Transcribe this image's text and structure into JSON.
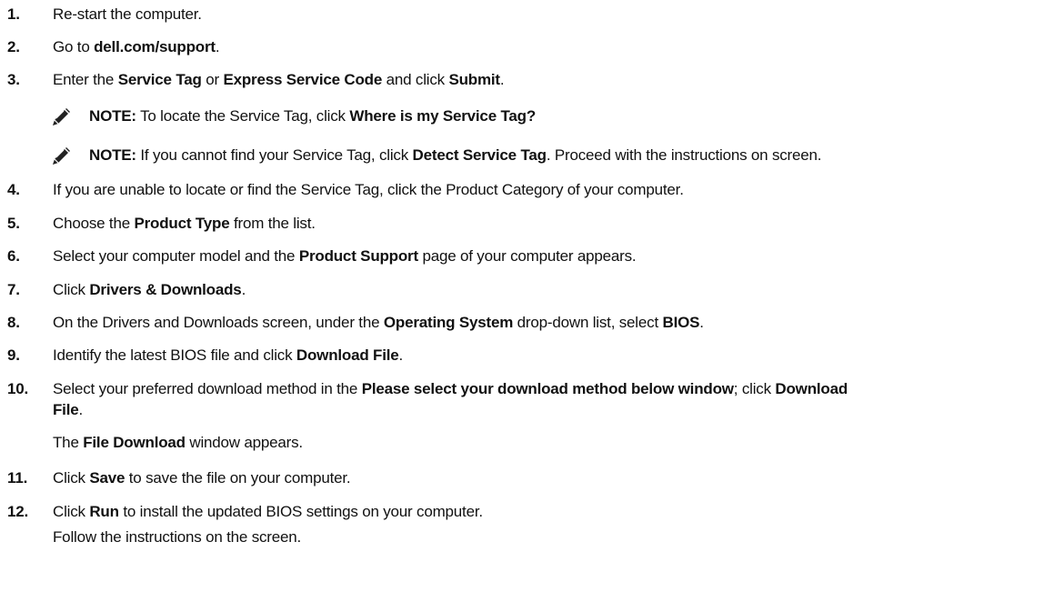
{
  "steps": [
    {
      "num": "1.",
      "parts": [
        {
          "t": "Re-start the computer.",
          "b": false
        }
      ]
    },
    {
      "num": "2.",
      "parts": [
        {
          "t": "Go to ",
          "b": false
        },
        {
          "t": "dell.com/support",
          "b": true
        },
        {
          "t": ".",
          "b": false
        }
      ]
    },
    {
      "num": "3.",
      "parts": [
        {
          "t": "Enter the ",
          "b": false
        },
        {
          "t": "Service Tag",
          "b": true
        },
        {
          "t": " or ",
          "b": false
        },
        {
          "t": "Express Service Code",
          "b": true
        },
        {
          "t": " and click ",
          "b": false
        },
        {
          "t": "Submit",
          "b": true
        },
        {
          "t": ".",
          "b": false
        }
      ]
    },
    {
      "num": "4.",
      "parts": [
        {
          "t": "If you are unable to locate or find the Service Tag, click the Product Category of your computer.",
          "b": false
        }
      ]
    },
    {
      "num": "5.",
      "parts": [
        {
          "t": "Choose the ",
          "b": false
        },
        {
          "t": "Product Type",
          "b": true
        },
        {
          "t": " from the list.",
          "b": false
        }
      ]
    },
    {
      "num": "6.",
      "parts": [
        {
          "t": "Select your computer model and the ",
          "b": false
        },
        {
          "t": "Product Support",
          "b": true
        },
        {
          "t": " page of your computer appears.",
          "b": false
        }
      ]
    },
    {
      "num": "7.",
      "parts": [
        {
          "t": "Click ",
          "b": false
        },
        {
          "t": "Drivers & Downloads",
          "b": true
        },
        {
          "t": ".",
          "b": false
        }
      ]
    },
    {
      "num": "8.",
      "parts": [
        {
          "t": "On the Drivers and Downloads screen, under the ",
          "b": false
        },
        {
          "t": "Operating System",
          "b": true
        },
        {
          "t": " drop-down list, select ",
          "b": false
        },
        {
          "t": "BIOS",
          "b": true
        },
        {
          "t": ".",
          "b": false
        }
      ]
    },
    {
      "num": "9.",
      "parts": [
        {
          "t": "Identify the latest BIOS file and click ",
          "b": false
        },
        {
          "t": "Download File",
          "b": true
        },
        {
          "t": ".",
          "b": false
        }
      ]
    },
    {
      "num": "10.",
      "parts": [
        {
          "t": "Select your preferred download method in the ",
          "b": false
        },
        {
          "t": "Please select your download method below window",
          "b": true
        },
        {
          "t": "; click ",
          "b": false
        },
        {
          "t": "Download",
          "b": true
        }
      ]
    },
    {
      "num": "11.",
      "parts": [
        {
          "t": "Click ",
          "b": false
        },
        {
          "t": "Save",
          "b": true
        },
        {
          "t": " to save the file on your computer.",
          "b": false
        }
      ]
    },
    {
      "num": "12.",
      "parts": [
        {
          "t": "Click ",
          "b": false
        },
        {
          "t": "Run",
          "b": true
        },
        {
          "t": " to install the updated BIOS settings on your computer.",
          "b": false
        }
      ]
    }
  ],
  "step10_cont": [
    {
      "t": "File",
      "b": true
    },
    {
      "t": ".",
      "b": false
    }
  ],
  "step10_sub": [
    {
      "t": "The ",
      "b": false
    },
    {
      "t": "File Download",
      "b": true
    },
    {
      "t": " window appears.",
      "b": false
    }
  ],
  "step12_sub": [
    {
      "t": "Follow the instructions on the screen.",
      "b": false
    }
  ],
  "notes": [
    {
      "parts": [
        {
          "t": "NOTE:",
          "b": true
        },
        {
          "t": " To locate the Service Tag, click ",
          "b": false
        },
        {
          "t": "Where is my Service Tag?",
          "b": true
        }
      ]
    },
    {
      "parts": [
        {
          "t": "NOTE:",
          "b": true
        },
        {
          "t": " If you cannot find your Service Tag, click ",
          "b": false
        },
        {
          "t": "Detect Service Tag",
          "b": true
        },
        {
          "t": ". Proceed with the instructions on screen.",
          "b": false
        }
      ]
    }
  ]
}
